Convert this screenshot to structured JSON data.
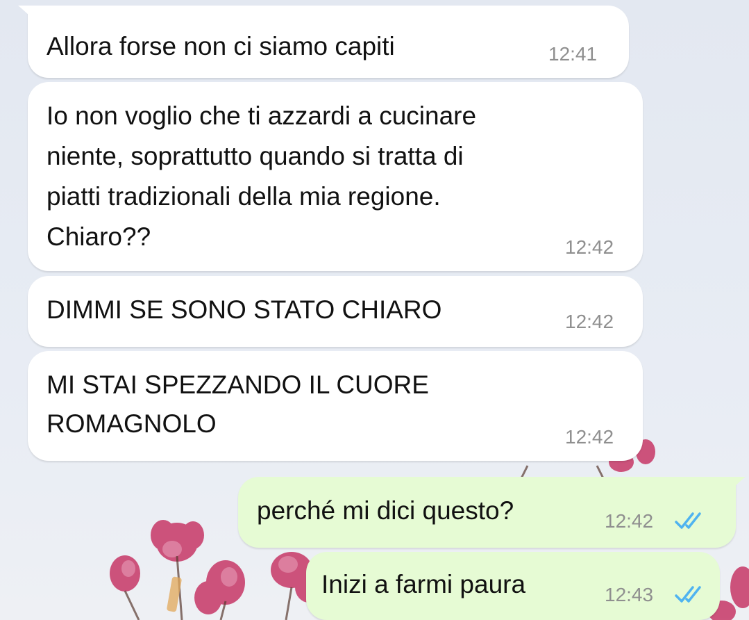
{
  "conversation": {
    "messages": [
      {
        "direction": "incoming",
        "lines": [
          "Allora forse non ci siamo capiti"
        ],
        "time": "12:41"
      },
      {
        "direction": "incoming",
        "lines": [
          "Io non voglio che ti azzardi a cucinare",
          "niente, soprattutto quando si tratta di",
          "piatti tradizionali della mia regione.",
          "Chiaro??"
        ],
        "time": "12:42"
      },
      {
        "direction": "incoming",
        "lines": [
          "DIMMI SE SONO STATO CHIARO"
        ],
        "time": "12:42"
      },
      {
        "direction": "incoming",
        "lines": [
          "MI STAI SPEZZANDO IL CUORE",
          "ROMAGNOLO"
        ],
        "time": "12:42"
      },
      {
        "direction": "outgoing",
        "lines": [
          "perché mi dici questo?"
        ],
        "time": "12:42",
        "status": "read"
      },
      {
        "direction": "outgoing",
        "lines": [
          "Inizi a farmi paura"
        ],
        "time": "12:43",
        "status": "read"
      }
    ]
  },
  "colors": {
    "incoming_bubble": "#ffffff",
    "outgoing_bubble": "#e6fbd4",
    "read_ticks": "#4fb3f0",
    "timestamp": "#8f8f8f",
    "wallpaper_flowers": "#c43d6b"
  },
  "icons": {
    "read_receipt": "double-check-icon"
  }
}
